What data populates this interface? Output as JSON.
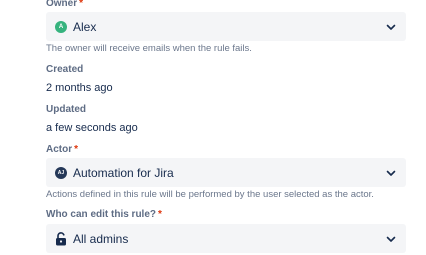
{
  "owner": {
    "label": "Owner",
    "required_mark": "*",
    "value": "Alex",
    "avatar_initial": "A",
    "avatar_color": "#36b37e",
    "help": "The owner will receive emails when the rule fails."
  },
  "created": {
    "label": "Created",
    "value": "2 months ago"
  },
  "updated": {
    "label": "Updated",
    "value": "a few seconds ago"
  },
  "actor": {
    "label": "Actor",
    "required_mark": "*",
    "value": "Automation for Jira",
    "avatar_initial": "AJ",
    "avatar_color": "#253858",
    "help": "Actions defined in this rule will be performed by the user selected as the actor."
  },
  "editors": {
    "label": "Who can edit this rule?",
    "required_mark": "*",
    "value": "All admins",
    "icon": "unlock-icon"
  },
  "colors": {
    "field_bg": "#f4f5f7",
    "required": "#de350b",
    "label": "#5e6c84",
    "text": "#172b4d"
  }
}
